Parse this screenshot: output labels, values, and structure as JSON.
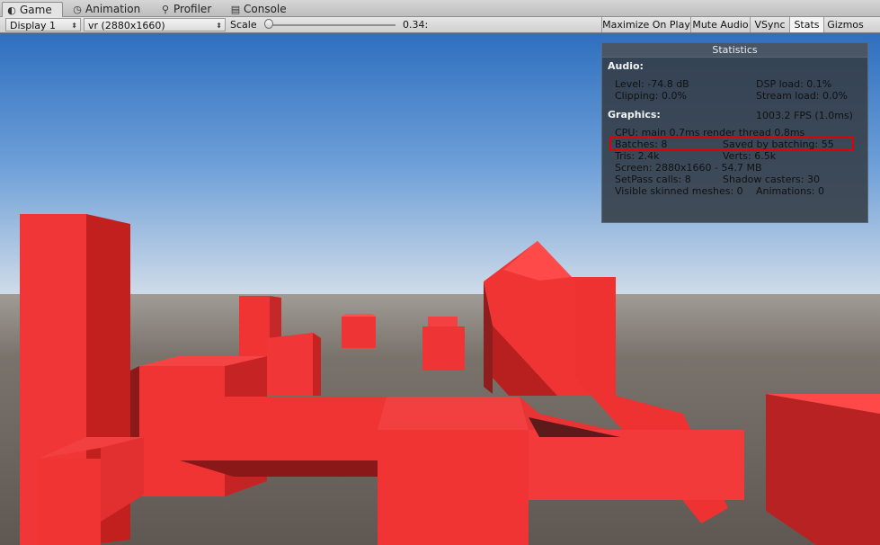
{
  "tabs": [
    {
      "label": "Game",
      "icon": "game-controller-icon",
      "glyph": "◐",
      "active": true
    },
    {
      "label": "Animation",
      "icon": "animation-clock-icon",
      "glyph": "◷",
      "active": false
    },
    {
      "label": "Profiler",
      "icon": "profiler-icon",
      "glyph": "⚲",
      "active": false
    },
    {
      "label": "Console",
      "icon": "console-icon",
      "glyph": "▤",
      "active": false
    }
  ],
  "toolbar": {
    "display": "Display 1",
    "resolution": "vr (2880x1660)",
    "scale_label": "Scale",
    "scale_value": "0.34:",
    "scale_level": 0.03,
    "maximize": "Maximize On Play",
    "mute": "Mute Audio",
    "vsync": "VSync",
    "stats": "Stats",
    "gizmos": "Gizmos",
    "dropdown_arrow": "⬍"
  },
  "stats": {
    "title": "Statistics",
    "audio_header": "Audio:",
    "level": "Level: -74.8 dB",
    "dsp_load": "DSP load: 0.1%",
    "clipping": "Clipping: 0.0%",
    "stream_load": "Stream load: 0.0%",
    "graphics_header": "Graphics:",
    "fps": "1003.2 FPS (1.0ms)",
    "cpu": "CPU: main 0.7ms  render thread 0.8ms",
    "batches": "Batches: 8",
    "saved_by_batching": "Saved by batching: 55",
    "tris": "Tris: 2.4k",
    "verts": "Verts: 6.5k",
    "screen": "Screen: 2880x1660 - 54.7 MB",
    "setpass": "SetPass calls: 8",
    "shadow_casters": "Shadow casters: 30",
    "skinned_meshes": "Visible skinned meshes: 0",
    "animations": "Animations: 0"
  },
  "colors": {
    "cube_front": "#f03434",
    "cube_top": "#ff4a4a",
    "cube_side": "#c42020",
    "cube_dark": "#8a1a1a",
    "highlight": "#e00000"
  }
}
